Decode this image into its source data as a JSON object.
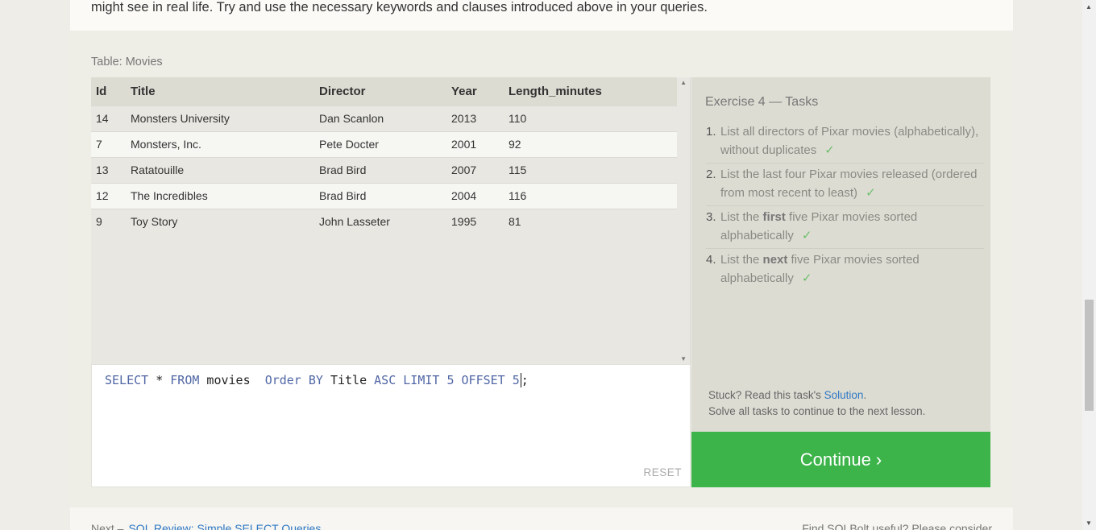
{
  "intro": {
    "text": "might see in real life. Try and use the necessary keywords and clauses introduced above in your queries."
  },
  "table": {
    "caption": "Table: Movies",
    "headers": [
      "Id",
      "Title",
      "Director",
      "Year",
      "Length_minutes"
    ],
    "rows": [
      [
        "14",
        "Monsters University",
        "Dan Scanlon",
        "2013",
        "110"
      ],
      [
        "7",
        "Monsters, Inc.",
        "Pete Docter",
        "2001",
        "92"
      ],
      [
        "13",
        "Ratatouille",
        "Brad Bird",
        "2007",
        "115"
      ],
      [
        "12",
        "The Incredibles",
        "Brad Bird",
        "2004",
        "116"
      ],
      [
        "9",
        "Toy Story",
        "John Lasseter",
        "1995",
        "81"
      ]
    ]
  },
  "editor": {
    "tokens": [
      "SELECT",
      " * ",
      "FROM",
      " movies  ",
      "Order",
      " ",
      "BY",
      " Title ",
      "ASC",
      " ",
      "LIMIT",
      " ",
      "5",
      " ",
      "OFFSET",
      " ",
      "5",
      ";"
    ],
    "reset_label": "RESET"
  },
  "tasks": {
    "title": "Exercise 4 — Tasks",
    "items": [
      {
        "num": "1.",
        "pre": "List all directors of Pixar movies (alphabetically), without duplicates",
        "bold": "",
        "post": "",
        "check": "✓"
      },
      {
        "num": "2.",
        "pre": "List the last four Pixar movies released (ordered from most recent to least)",
        "bold": "",
        "post": "",
        "check": "✓"
      },
      {
        "num": "3.",
        "pre": "List the ",
        "bold": "first",
        "post": " five Pixar movies sorted alphabetically",
        "check": "✓"
      },
      {
        "num": "4.",
        "pre": "List the ",
        "bold": "next",
        "post": " five Pixar movies sorted alphabetically",
        "check": "✓"
      }
    ],
    "hint_prefix": "Stuck? Read this task's ",
    "hint_link": "Solution",
    "hint_suffix": ".",
    "hint_line2": "Solve all tasks to continue to the next lesson."
  },
  "continue_label": "Continue ›",
  "footer": {
    "next_prefix": "Next –",
    "next_link": "SQL Review: Simple SELECT Queries",
    "plug": "Find SQLBolt useful? Please consider"
  },
  "colors": {
    "accent_green": "#3cb44a",
    "link_blue": "#2f78c4",
    "keyword_blue": "#5167a5"
  }
}
